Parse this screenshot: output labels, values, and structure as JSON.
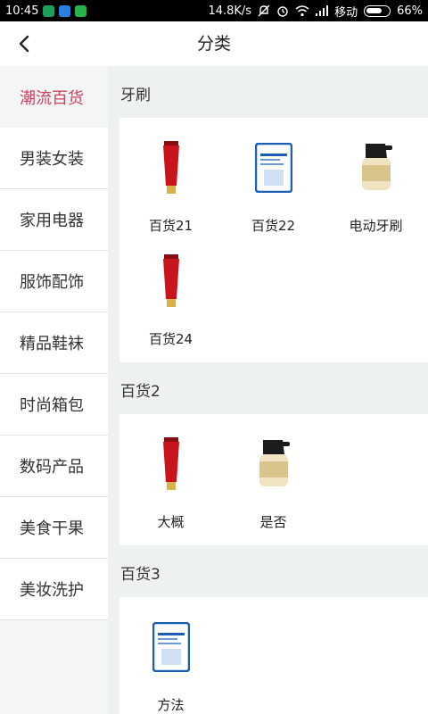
{
  "status_bar": {
    "time": "10:45",
    "speed": "14.8K/s",
    "carrier": "移动",
    "battery": "66%"
  },
  "header": {
    "title": "分类"
  },
  "sidebar": {
    "items": [
      {
        "label": "潮流百货",
        "active": true
      },
      {
        "label": "男装女装"
      },
      {
        "label": "家用电器"
      },
      {
        "label": "服饰配饰"
      },
      {
        "label": "精品鞋袜"
      },
      {
        "label": "时尚箱包"
      },
      {
        "label": "数码产品"
      },
      {
        "label": "美食干果"
      },
      {
        "label": "美妆洗护"
      }
    ]
  },
  "sections": [
    {
      "title": "牙刷",
      "products": [
        {
          "name": "百货21",
          "icon": "red-tube-icon"
        },
        {
          "name": "百货22",
          "icon": "face-mask-pack-icon"
        },
        {
          "name": "电动牙刷",
          "icon": "cream-jar-icon"
        },
        {
          "name": "百货24",
          "icon": "red-tube-icon"
        }
      ]
    },
    {
      "title": "百货2",
      "products": [
        {
          "name": "大概",
          "icon": "red-tube-icon"
        },
        {
          "name": "是否",
          "icon": "cream-jar-icon"
        }
      ]
    },
    {
      "title": "百货3",
      "products": [
        {
          "name": "方法",
          "icon": "face-mask-pack-icon"
        }
      ]
    }
  ],
  "colors": {
    "accent": "#d23f5c",
    "sidebar_bg": "#f4f6f6",
    "content_bg": "#eef1f2",
    "tube_red": "#c8141c",
    "mask_blue": "#1a5fb4",
    "jar_gold": "#d9c58b"
  }
}
